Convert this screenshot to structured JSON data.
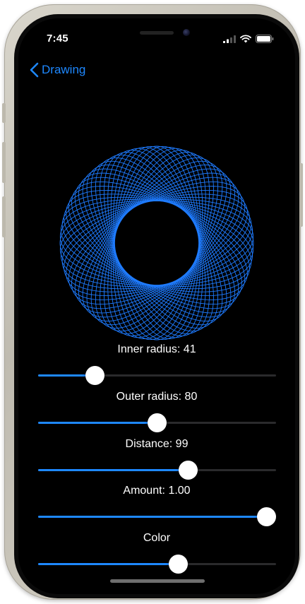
{
  "status_bar": {
    "time": "7:45",
    "icons": [
      "cellular-signal-icon",
      "wifi-icon",
      "battery-icon"
    ]
  },
  "nav": {
    "back_label": "Drawing",
    "back_icon": "chevron-left-icon"
  },
  "colors": {
    "accent": "#1e88ff",
    "drawing": "#1e7bff",
    "background": "#000000",
    "track": "#2a2a2c"
  },
  "drawing": {
    "type": "spirograph",
    "inner_radius": 41,
    "outer_radius": 80,
    "distance": 99,
    "amount": 1.0
  },
  "controls": [
    {
      "id": "inner-radius",
      "label": "Inner radius: 41",
      "value": 0.24
    },
    {
      "id": "outer-radius",
      "label": "Outer radius: 80",
      "value": 0.5
    },
    {
      "id": "distance",
      "label": "Distance: 99",
      "value": 0.63
    },
    {
      "id": "amount",
      "label": "Amount: 1.00",
      "value": 1.0
    },
    {
      "id": "color",
      "label": "Color",
      "value": 0.59
    }
  ]
}
